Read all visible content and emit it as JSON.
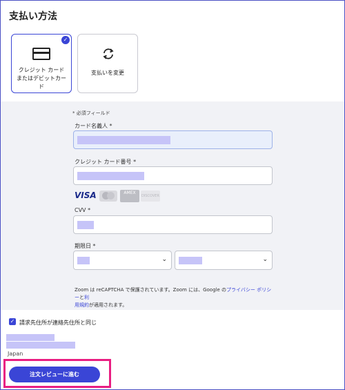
{
  "page": {
    "title": "支払い方法"
  },
  "methods": [
    {
      "label_line1": "クレジット カード",
      "label_line2": "またはデビットカー",
      "label_line3": "ド",
      "selected": true,
      "icon": "credit-card-icon"
    },
    {
      "label": "支払いを変更",
      "selected": false,
      "icon": "refresh-icon"
    }
  ],
  "form": {
    "required_note": "* 必須フィールド",
    "cardholder_label": "カード名義人 *",
    "card_number_label": "クレジット カード番号 *",
    "logos": {
      "visa": "VISA",
      "amex": "AMEX",
      "discover": "DISCOVER"
    },
    "cvv_label": "CVV *",
    "expiry_label": "期限日 *",
    "recaptcha_text_1": "Zoom は reCAPTCHA で保護されています。Zoom には、Google の",
    "recaptcha_link_1": "プライバシー ポリシー",
    "recaptcha_text_2": "と",
    "recaptcha_link_2a": "利",
    "recaptcha_link_2b": "用規約",
    "recaptcha_text_3": "が適用されます。"
  },
  "billing": {
    "same_as_contact_label": "請求先住所が連絡先住所と同じ",
    "checked": true,
    "country": "Japan"
  },
  "actions": {
    "submit_label": "注文レビューに進む"
  },
  "colors": {
    "accent": "#3a45d6",
    "highlight": "#e91e82",
    "redaction": "#c6c4f8"
  }
}
